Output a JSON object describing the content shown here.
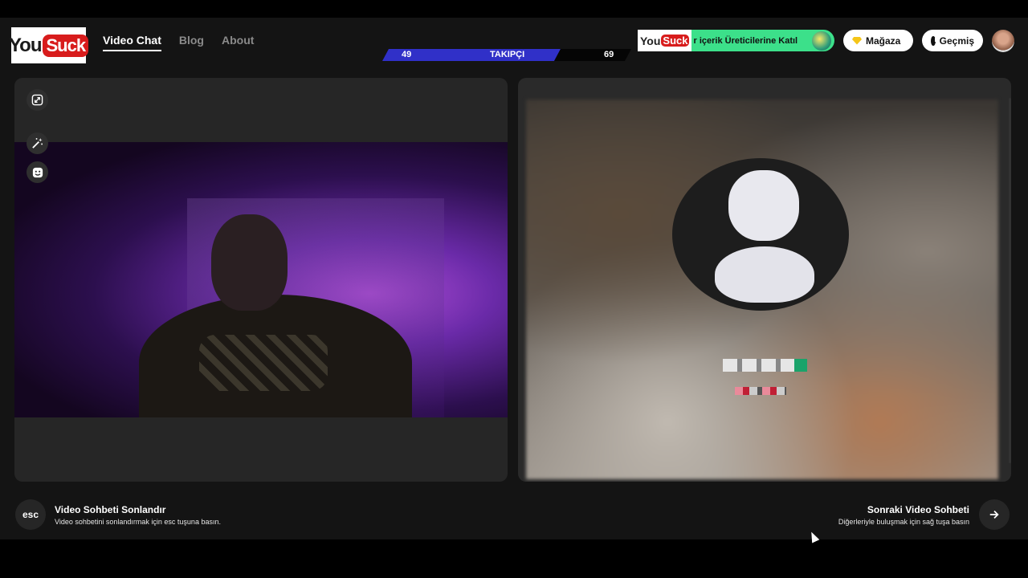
{
  "header": {
    "logo": {
      "you": "You",
      "suck": "Suck"
    },
    "nav": [
      {
        "label": "Video Chat",
        "active": true
      },
      {
        "label": "Blog",
        "active": false
      },
      {
        "label": "About",
        "active": false
      }
    ],
    "followers": {
      "left": "49",
      "label": "TAKIPÇI",
      "right": "69",
      "fill_fraction": 0.72,
      "accent": "#3030c8"
    },
    "banner": {
      "mini_you": "You",
      "mini_suck": "Suck",
      "text": "r içerik Üreticilerine Katıl",
      "color": "#3ce08a"
    },
    "shop_label": "Mağaza",
    "history_label": "Geçmiş"
  },
  "footer": {
    "end": {
      "key": "esc",
      "title": "Video Sohbeti Sonlandır",
      "subtitle": "Video sohbetini sonlandırmak için esc tuşuna basın."
    },
    "next": {
      "key": "→",
      "title": "Sonraki Video Sohbeti",
      "subtitle": "Diğerleriyle buluşmak için sağ tuşa basın"
    }
  },
  "icons": [
    "expand-icon",
    "magic-wand-icon",
    "emoji-icon",
    "gem-icon",
    "clock-icon",
    "arrow-right-icon"
  ]
}
